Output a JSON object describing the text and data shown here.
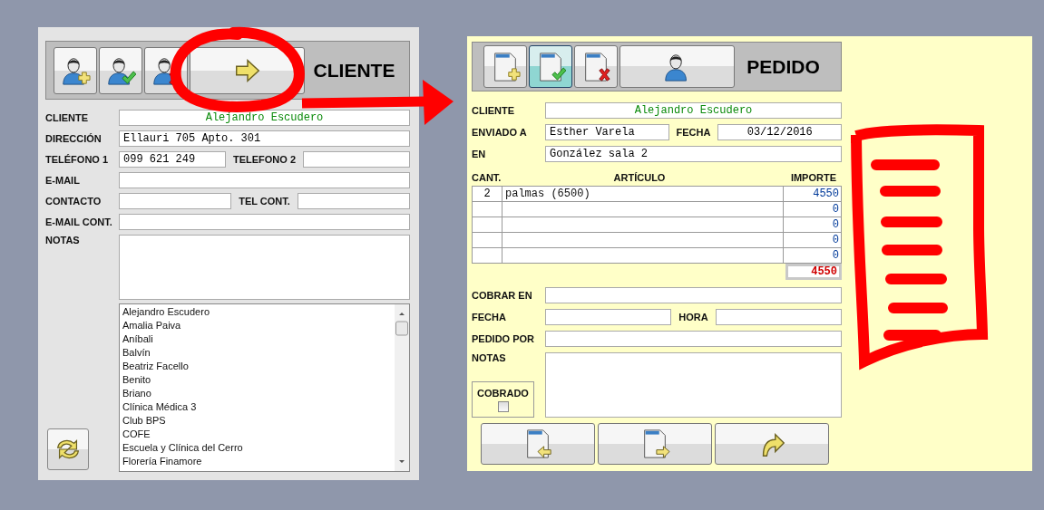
{
  "cliente": {
    "toolbar": [
      {
        "selected": false
      },
      {
        "selected": false
      },
      {
        "selected": false
      },
      {
        "selected": false
      }
    ],
    "title": "CLIENTE",
    "rows": [
      {
        "fields": [
          {
            "label": "CLIENTE",
            "value": "Alejandro Escudero",
            "kind": "name"
          }
        ]
      },
      {
        "fields": [
          {
            "label": "DIRECCIÓN",
            "value": "Ellauri 705 Apto. 301",
            "kind": "text"
          }
        ]
      },
      {
        "fields": [
          {
            "label": "TELÉFONO 1",
            "value": "099 621 249",
            "kind": "text"
          },
          {
            "label": "TELEFONO 2",
            "kind": "text"
          }
        ]
      },
      {
        "fields": [
          {
            "label": "E-MAIL",
            "kind": "text"
          }
        ]
      },
      {
        "fields": [
          {
            "label": "CONTACTO",
            "kind": "text"
          },
          {
            "label": "TEL CONT.",
            "kind": "text"
          }
        ]
      },
      {
        "fields": [
          {
            "label": "E-MAIL CONT.",
            "kind": "text"
          }
        ]
      }
    ],
    "notes_label": "NOTAS",
    "list": [
      "Alejandro Escudero",
      "Amalia Paiva",
      "Aníbali",
      "Balvín",
      "Beatriz Facello",
      "Benito",
      "Briano",
      "Clínica Médica 3",
      "Club BPS",
      "COFE",
      "Escuela y Clínica del Cerro",
      "Florería Finamore"
    ]
  },
  "pedido": {
    "toolbar": [
      {
        "selected": false
      },
      {
        "selected": true
      },
      {
        "selected": false
      },
      {
        "selected": false
      }
    ],
    "title": "PEDIDO",
    "rows": [
      {
        "fields": [
          {
            "label": "CLIENTE",
            "value": "Alejandro Escudero",
            "kind": "name"
          }
        ]
      },
      {
        "fields": [
          {
            "label": "ENVIADO A",
            "value": "Esther Varela",
            "kind": "text"
          },
          {
            "label": "FECHA",
            "value": "03/12/2016",
            "kind": "center"
          }
        ]
      },
      {
        "fields": [
          {
            "label": "EN",
            "value": "González sala 2",
            "kind": "text"
          }
        ]
      }
    ],
    "table": {
      "columns": [
        "CANT.",
        "ARTÍCULO",
        "IMPORTE"
      ],
      "rows": [
        {
          "cant": "2",
          "articulo": "palmas (6500)",
          "importe": "4550"
        },
        {
          "importe": "0"
        },
        {
          "importe": "0"
        },
        {
          "importe": "0"
        },
        {
          "importe": "0"
        }
      ],
      "total": "4550"
    },
    "rows2": [
      {
        "fields": [
          {
            "label": "COBRAR EN",
            "kind": "text"
          }
        ]
      },
      {
        "fields": [
          {
            "label": "FECHA",
            "kind": "text"
          },
          {
            "label": "HORA",
            "kind": "text"
          }
        ]
      },
      {
        "fields": [
          {
            "label": "PEDIDO POR",
            "kind": "text"
          }
        ]
      }
    ],
    "notes_label": "NOTAS",
    "cobrado": {
      "label": "COBRADO",
      "checked": false
    }
  }
}
